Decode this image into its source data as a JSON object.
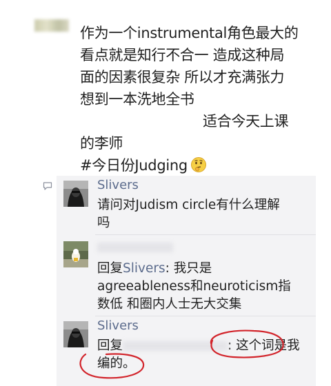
{
  "post": {
    "lines": [
      "作为一个instrumental角色最大的",
      "看点就是知行不合一 造成这种局",
      "面的因素很复杂 所以才充满张力",
      "想到一本洗地全书",
      "适合今天上课",
      "的李师",
      "#今日份Judging"
    ]
  },
  "comments": [
    {
      "author": "Slivers",
      "lines": [
        "请问对Judism circle有什么理解",
        "吗"
      ]
    },
    {
      "reply_prefix": "回复",
      "reply_to": "Slivers",
      "colon": ":",
      "lines_first": "我只是",
      "lines": [
        "agreeableness和neuroticism指",
        "数低 和圈内人士无大交集"
      ]
    },
    {
      "author": "Slivers",
      "reply_prefix": "回复",
      "colon": ":",
      "highlight_1": "这个词是我",
      "highlight_2": "编的。"
    }
  ],
  "icons": {
    "comment": "comment-bubble-icon",
    "emoji": "thinking-face-icon"
  },
  "colors": {
    "name": "#5b6b8c",
    "annotation": "#d2232a",
    "comment_bg": "#f3f3f5"
  }
}
